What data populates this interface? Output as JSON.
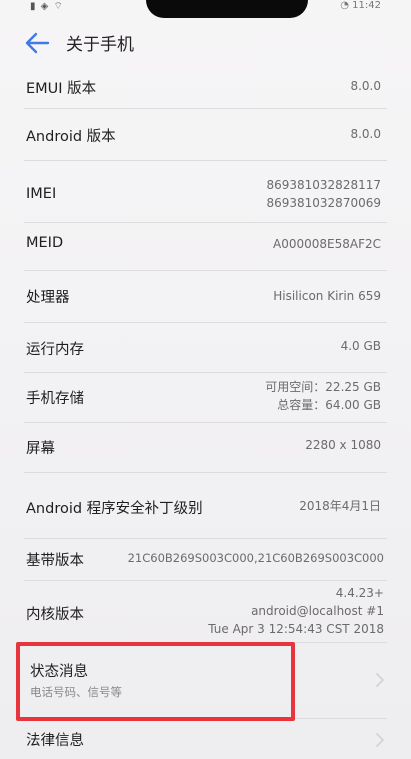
{
  "status_bar": {
    "left_text": "▮ ◈ ⌔",
    "right_text": "◔ 11:42"
  },
  "header": {
    "title": "关于手机"
  },
  "rows": {
    "emui": {
      "label": "EMUI 版本",
      "value": "8.0.0"
    },
    "android": {
      "label": "Android 版本",
      "value": "8.0.0"
    },
    "imei": {
      "label": "IMEI",
      "value_line1": "869381032828117",
      "value_line2": "869381032870069"
    },
    "meid": {
      "label": "MEID",
      "value": "A000008E58AF2C"
    },
    "cpu": {
      "label": "处理器",
      "value": "Hisilicon Kirin 659"
    },
    "ram": {
      "label": "运行内存",
      "value": "4.0 GB"
    },
    "storage": {
      "label": "手机存储",
      "value_line1": "可用空间：22.25 GB",
      "value_line2": "总容量：64.00 GB"
    },
    "screen": {
      "label": "屏幕",
      "value": "2280 x 1080"
    },
    "security_patch": {
      "label": "Android 程序安全补丁级别",
      "value": "2018年4月1日"
    },
    "baseband": {
      "label": "基带版本",
      "value": "21C60B269S003C000,21C60B269S003C000"
    },
    "kernel": {
      "label": "内核版本",
      "value_line1": "4.4.23+",
      "value_line2": "android@localhost #1",
      "value_line3": "Tue Apr 3 12:54:43 CST 2018"
    },
    "status_info": {
      "label": "状态消息",
      "sub": "电话号码、信号等"
    },
    "legal": {
      "label": "法律信息"
    }
  },
  "colors": {
    "highlight": "#e8343d",
    "back_arrow": "#3e7ae8"
  },
  "icons": [
    "back-arrow-icon",
    "chevron-right-icon"
  ]
}
